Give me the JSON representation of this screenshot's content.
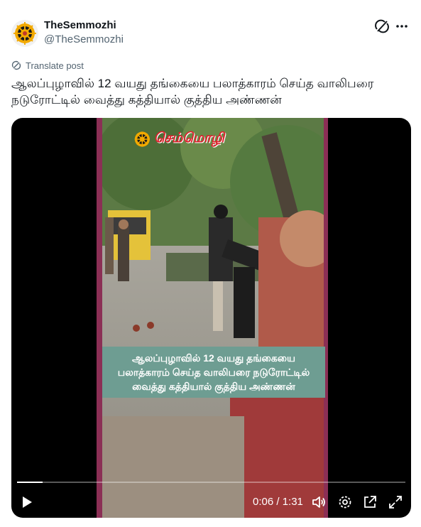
{
  "post": {
    "author_name": "TheSemmozhi",
    "author_handle": "@TheSemmozhi",
    "translate_label": "Translate post",
    "text": "ஆலப்புழாவில் 12 வயது தங்கையை பலாத்காரம் செய்த வாலிபரை நடுரோட்டில் வைத்து கத்தியால் குத்திய அண்ணன்"
  },
  "video": {
    "watermark": "செம்மொழி",
    "caption_lines": [
      "ஆலப்புழாவில் 12 வயது தங்கையை",
      "பலாத்காரம் செய்த வாலிபரை நடுரோட்டில்",
      "வைத்து கத்தியால் குத்திய அண்ணன்"
    ],
    "time_display": "0:06 / 1:31",
    "progress_fraction": 0.066
  },
  "icons": {
    "grok": "grok-icon",
    "more": "more-options-icon",
    "translate": "translate-icon",
    "play": "play-icon",
    "volume": "volume-icon",
    "settings": "settings-icon",
    "popout": "popout-icon",
    "fullscreen": "fullscreen-icon"
  },
  "colors": {
    "brand_frame": "#8b2f55",
    "caption_bg": "#6e9d92",
    "watermark_red": "#e0202c"
  }
}
